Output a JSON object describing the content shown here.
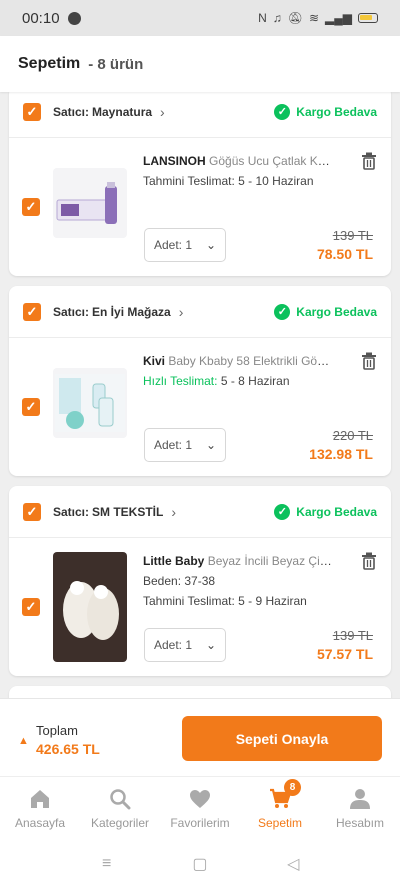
{
  "status_bar": {
    "time": "00:10",
    "right_text": "N"
  },
  "header": {
    "title": "Sepetim",
    "count": "- 8 ürün"
  },
  "sellers": [
    {
      "label": "Satıcı:",
      "name": "Maynatura",
      "cargo": "Kargo Bedava",
      "product": {
        "brand": "LANSINOH",
        "desc": "Göğüs Ucu Çatlak Kre...",
        "delivery_prefix": "Tahmini Teslimat:",
        "delivery": "5 - 10 Haziran",
        "qty": "Adet: 1",
        "old_price": "139 TL",
        "new_price": "78.50 TL"
      }
    },
    {
      "label": "Satıcı:",
      "name": "En İyi Mağaza",
      "cargo": "Kargo Bedava",
      "product": {
        "brand": "Kivi",
        "desc": "Baby Kbaby 58 Elektrikli Göğü...",
        "delivery_prefix": "Hızlı Teslimat:",
        "delivery": "5 - 8 Haziran",
        "qty": "Adet: 1",
        "old_price": "220 TL",
        "new_price": "132.98 TL"
      }
    },
    {
      "label": "Satıcı:",
      "name": "SM TEKSTİL",
      "cargo": "Kargo Bedava",
      "product": {
        "brand": "Little Baby",
        "desc": "Beyaz İncili Beyaz Çiçe...",
        "size": "Beden: 37-38",
        "delivery_prefix": "Tahmini Teslimat:",
        "delivery": "5 - 9 Haziran",
        "qty": "Adet: 1",
        "old_price": "139 TL",
        "new_price": "57.57 TL"
      }
    }
  ],
  "footer": {
    "total_label": "Toplam",
    "total_value": "426.65 TL",
    "confirm_label": "Sepeti Onayla"
  },
  "tabs": [
    {
      "label": "Anasayfa",
      "icon": "home-icon"
    },
    {
      "label": "Kategoriler",
      "icon": "search-icon"
    },
    {
      "label": "Favorilerim",
      "icon": "heart-icon"
    },
    {
      "label": "Sepetim",
      "icon": "cart-icon",
      "badge": "8",
      "active": true
    },
    {
      "label": "Hesabım",
      "icon": "user-icon"
    }
  ],
  "colors": {
    "accent": "#f27a1a",
    "success": "#0bc15c"
  }
}
